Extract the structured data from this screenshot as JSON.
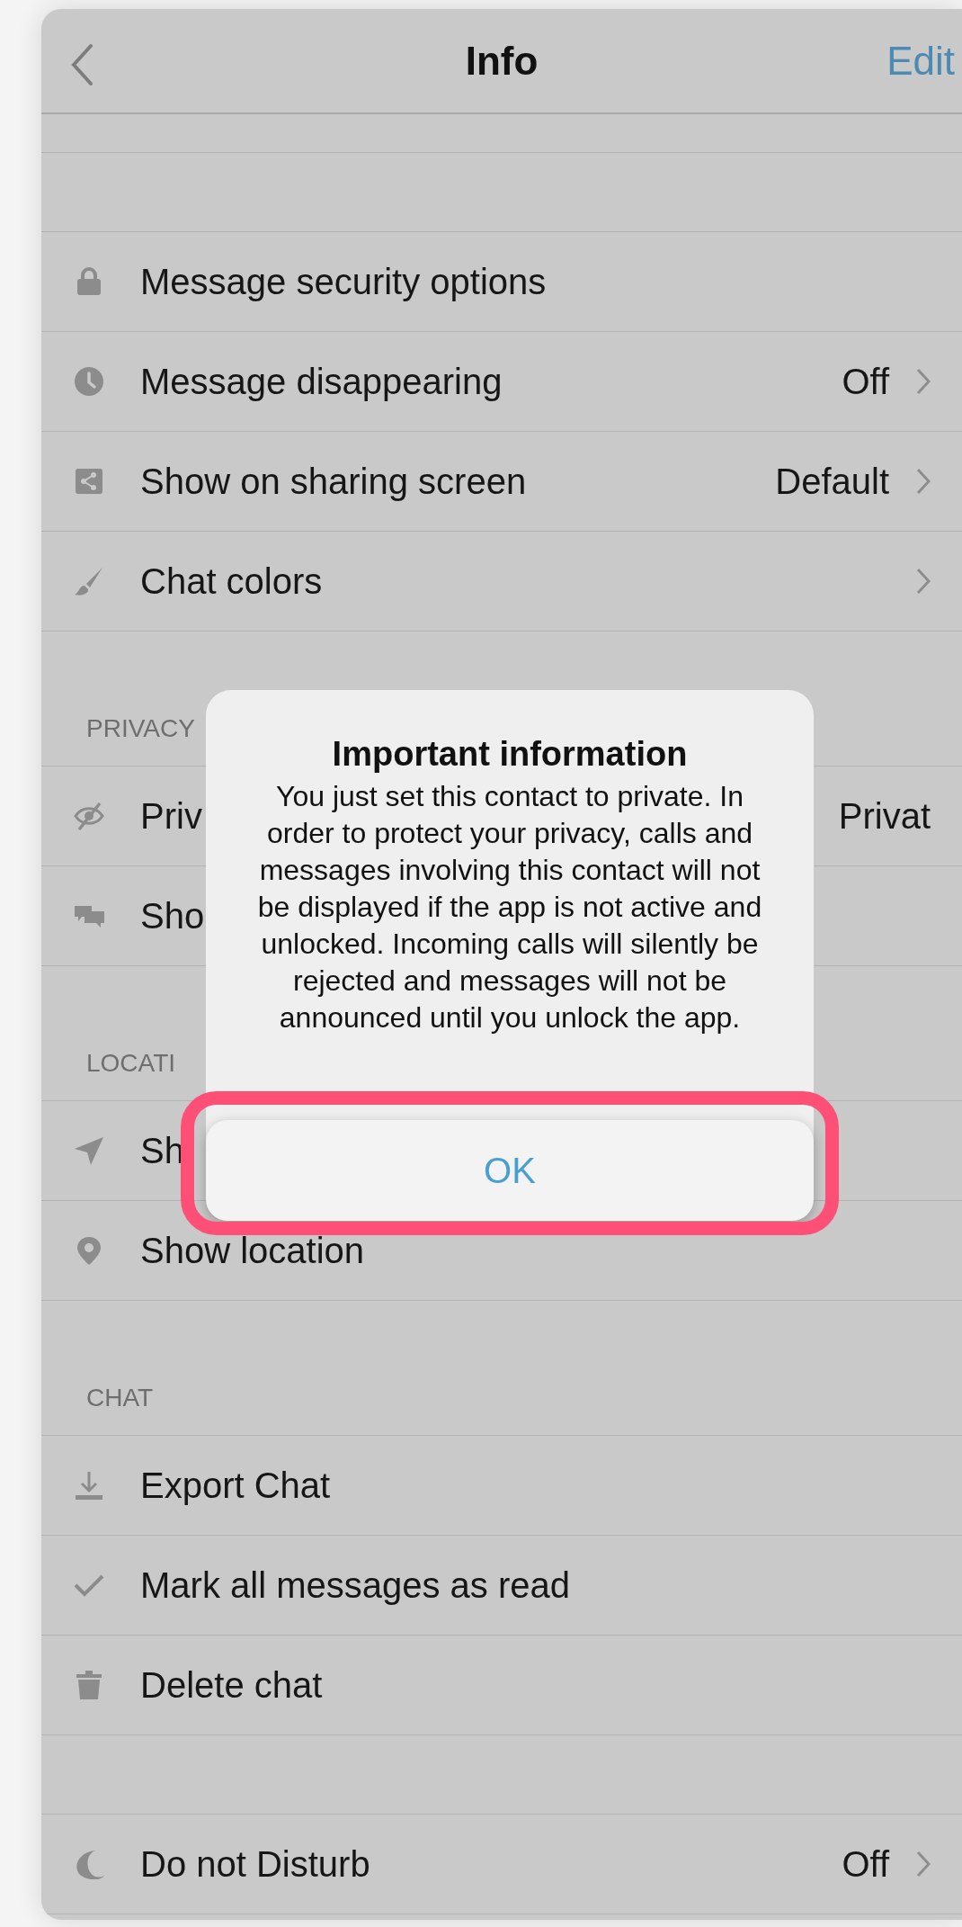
{
  "nav": {
    "title": "Info",
    "right_button": "Edit"
  },
  "sections": [
    {
      "rows": [
        {
          "label": "Message security options"
        },
        {
          "label": "Message disappearing",
          "value": "Off",
          "chevron": true
        },
        {
          "label": "Show on sharing screen",
          "value": "Default",
          "chevron": true
        },
        {
          "label": "Chat colors",
          "chevron": true
        }
      ]
    },
    {
      "header": "PRIVACY",
      "rows": [
        {
          "label": "Priv",
          "value": "Privat"
        },
        {
          "label": "Sho"
        }
      ]
    },
    {
      "header": "LOCATI",
      "rows": [
        {
          "label": "Sh"
        },
        {
          "label": "Show location"
        }
      ]
    },
    {
      "header": "CHAT",
      "rows": [
        {
          "label": "Export Chat"
        },
        {
          "label": "Mark all messages as read"
        },
        {
          "label": "Delete chat"
        }
      ]
    },
    {
      "rows": [
        {
          "label": "Do not Disturb",
          "value": "Off",
          "chevron": true
        }
      ]
    }
  ],
  "dialog": {
    "title": "Important information",
    "message": "You just set this contact to private. In order to protect your privacy, calls and messages involving this contact will not be displayed if the app is not active and unlocked. Incoming calls will silently be rejected and messages will not be announced until you unlock the app.",
    "button": {
      "label": "OK",
      "highlighted": true
    }
  }
}
